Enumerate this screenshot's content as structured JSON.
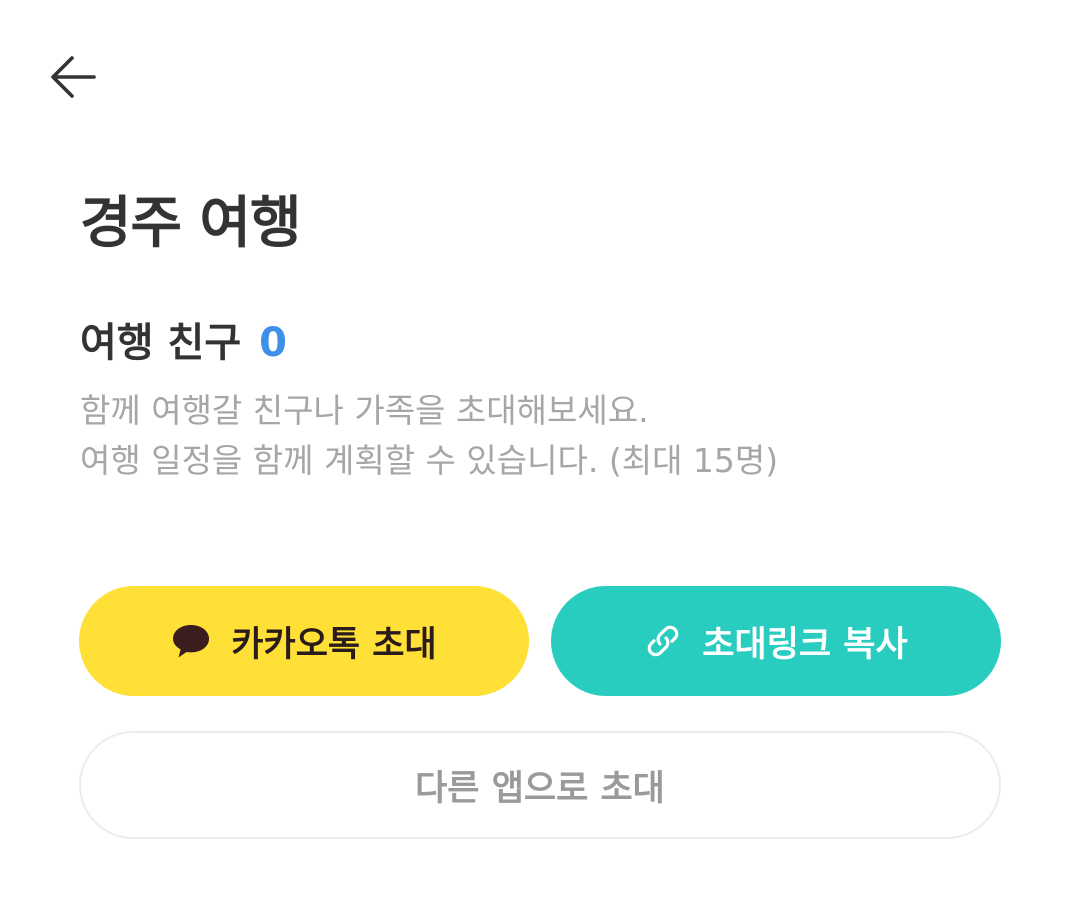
{
  "header": {
    "back_icon": "arrow-left-icon"
  },
  "trip": {
    "title": "경주 여행"
  },
  "friends": {
    "label": "여행 친구",
    "count": "0",
    "count_color": "#3d8fe8"
  },
  "description": {
    "line1": "함께 여행갈 친구나 가족을 초대해보세요.",
    "line2": "여행 일정을 함께 계획할 수 있습니다. (최대 15명)"
  },
  "actions": {
    "kakao": {
      "label": "카카오톡 초대",
      "icon": "speech-bubble-icon",
      "bg": "#fee037"
    },
    "link": {
      "label": "초대링크 복사",
      "icon": "link-icon",
      "bg": "#28cdc0"
    },
    "other": {
      "label": "다른 앱으로 초대"
    }
  }
}
